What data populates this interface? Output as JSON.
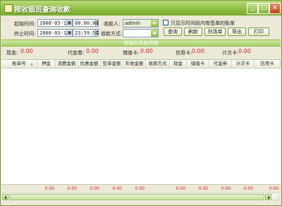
{
  "window": {
    "title": "按收银员查询收款",
    "minimize_label": "_",
    "restore_label": "□",
    "close_label": "×"
  },
  "filters": {
    "start_label": "起始时间:",
    "start_date": "2008-03-11",
    "start_time": "00:00:01",
    "end_label": "终止时间:",
    "end_date": "2008-03-11",
    "end_time": "23:59:59",
    "cashier_label": "收款人:",
    "cashier_value": "admin",
    "method_label": "收款方式:",
    "method_value": "",
    "only_with_bills_label": "只显示时间段内有签单的账单"
  },
  "buttons": {
    "query": "查询",
    "refresh": "刷新",
    "detail": "列清单",
    "export": "导出",
    "print": "打印"
  },
  "section_title": "收银员收款明细",
  "summary": {
    "cash_label": "现金:",
    "cash_value": "0.00",
    "voucher_label": "代金卷:",
    "voucher_value": "0.00",
    "savings_label": "储值卡:",
    "savings_value": "0.00",
    "credit_label": "信用卡:",
    "credit_value": "0.00",
    "count_card_label": "计次卡:",
    "count_card_value": "0.00"
  },
  "table": {
    "columns": [
      "账单号",
      "押金",
      "消费金额",
      "优惠金额",
      "签单金额",
      "实收金额",
      "收款方式",
      "现金",
      "储值卡",
      "代金券",
      "计次卡",
      "信用卡"
    ],
    "rows": [],
    "footer": [
      "",
      "0.00",
      "0.00",
      "0.00",
      "0.00",
      "0.00",
      "",
      "0.00",
      "0.00",
      "0.00",
      "0.00",
      "0.00"
    ]
  }
}
